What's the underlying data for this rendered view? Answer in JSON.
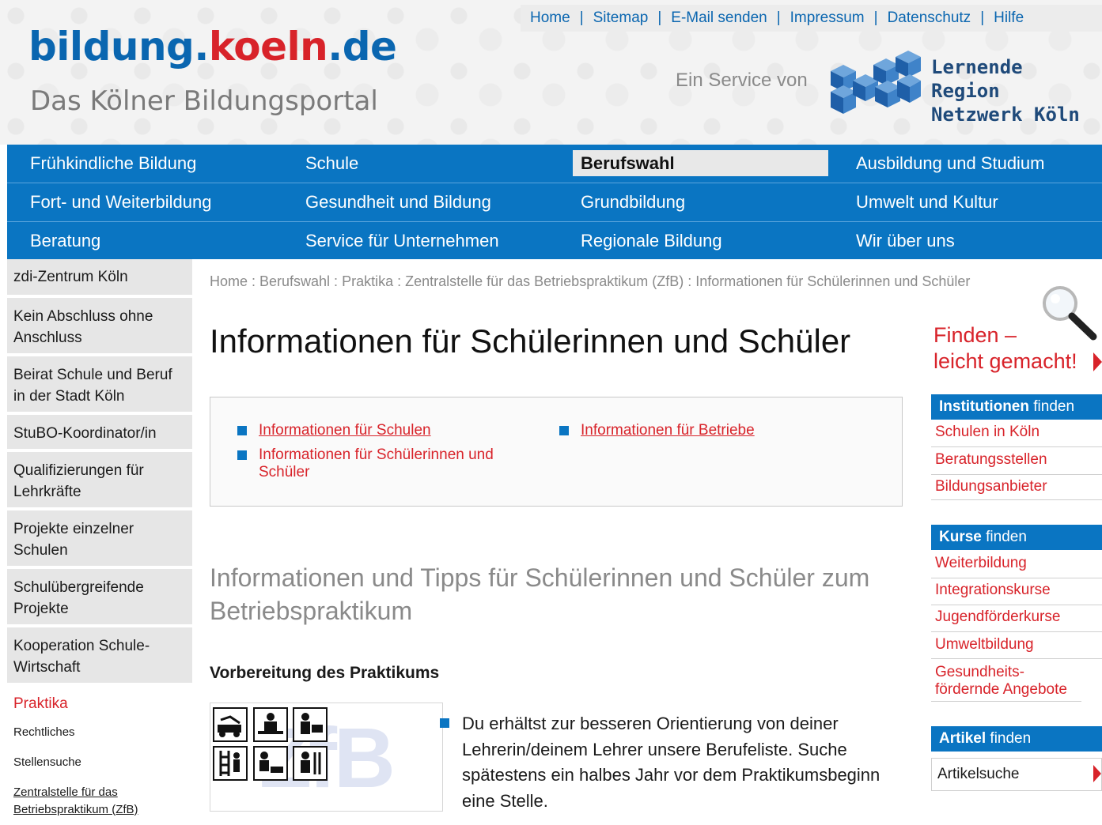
{
  "header": {
    "logo_part1": "bildung.",
    "logo_part2": "koeln",
    "logo_part3": ".de",
    "subtitle": "Das Kölner Bildungsportal",
    "service_label": "Ein Service von",
    "partner_line1": "Lernende Region",
    "partner_line2": "Netzwerk Köln",
    "top_links": [
      "Home",
      "Sitemap",
      "E-Mail senden",
      "Impressum",
      "Datenschutz",
      "Hilfe"
    ],
    "separator": "|"
  },
  "main_nav": {
    "row1": [
      "Frühkindliche Bildung",
      "Schule",
      "Berufswahl",
      "Ausbildung und Studium"
    ],
    "row2": [
      "Fort- und Weiterbildung",
      "Gesundheit und Bildung",
      "Grundbildung",
      "Umwelt und Kultur"
    ],
    "row3": [
      "Beratung",
      "Service für Unternehmen",
      "Regionale Bildung",
      "Wir über uns"
    ],
    "active": "Berufswahl"
  },
  "left_nav": {
    "items": [
      "zdi-Zentrum Köln",
      "Kein Abschluss ohne Anschluss",
      "Beirat Schule und Beruf in der Stadt Köln",
      "StuBO-Koordinator/in",
      "Qualifizierungen für Lehrkräfte",
      "Projekte einzelner Schulen",
      "Schulübergreifende Projekte",
      "Kooperation Schule-Wirtschaft"
    ],
    "active_item": "Praktika",
    "sub_items": [
      "Rechtliches",
      "Stellensuche",
      "Zentralstelle für das Betriebspraktikum (ZfB)"
    ]
  },
  "content": {
    "breadcrumb": "Home : Berufswahl : Praktika : Zentralstelle für das Betriebspraktikum (ZfB) : Informationen für Schülerinnen und Schüler",
    "title": "Informationen für Schülerinnen und Schüler",
    "link_box": {
      "link1": "Informationen für Schulen",
      "link2": "Informationen für Schülerinnen und Schüler",
      "link3": "Informationen für Betriebe"
    },
    "subtitle": "Informationen und Tipps für Schülerinnen und Schüler zum Betriebspraktikum",
    "section_heading": "Vorbereitung des Praktikums",
    "image_text": "ZfB",
    "paragraph": "Du erhältst zur besseren Orientierung von deiner Lehrerin/deinem Lehrer unsere Berufeliste. Suche spätestens ein halbes Jahr vor dem Praktikumsbeginn eine Stelle."
  },
  "right_sidebar": {
    "finden_line1": "Finden –",
    "finden_line2": "leicht gemacht!",
    "institutionen": {
      "bold": "Institutionen",
      "rest": " finden",
      "links": [
        "Schulen in Köln",
        "Beratungsstellen",
        "Bildungsanbieter"
      ]
    },
    "kurse": {
      "bold": "Kurse",
      "rest": " finden",
      "links": [
        "Weiterbildung",
        "Integrationskurse",
        "Jugendförderkurse",
        "Umweltbildung",
        "Gesundheits-fördernde Angebote"
      ]
    },
    "artikel": {
      "bold": "Artikel",
      "rest": " finden",
      "search_placeholder": "Artikelsuche"
    }
  },
  "colors": {
    "brand_blue": "#0a75c2",
    "brand_red": "#d8232a",
    "logo_blue": "#0a66b0"
  }
}
